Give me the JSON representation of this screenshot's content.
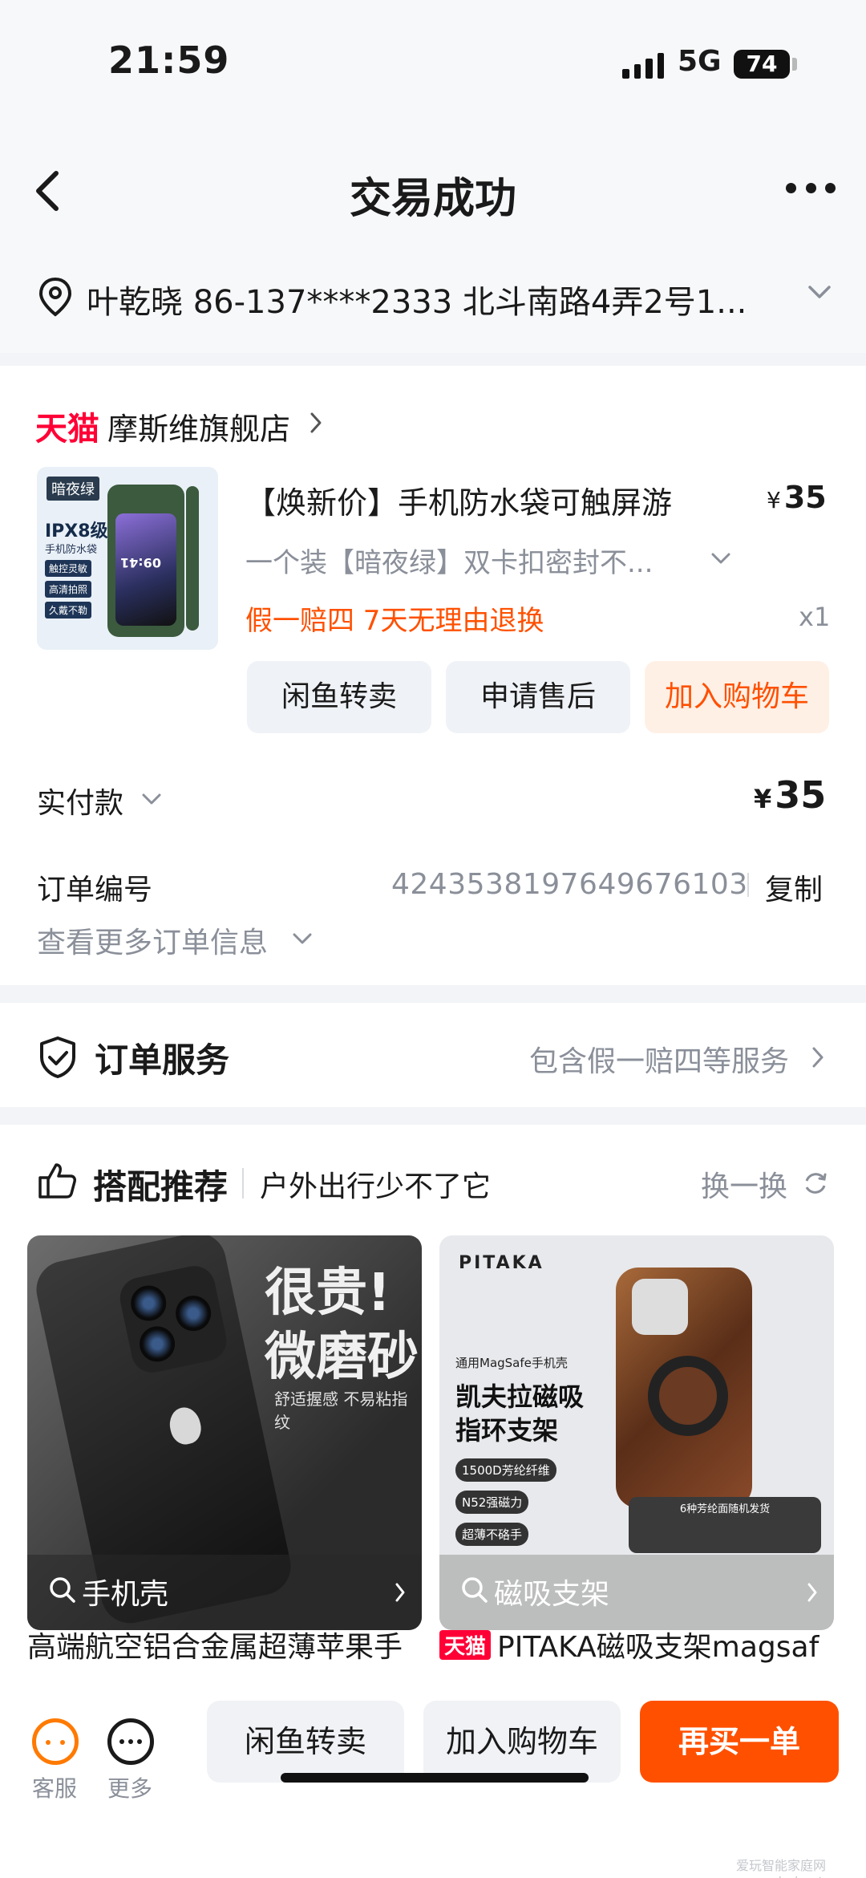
{
  "status_bar": {
    "time": "21:59",
    "network": "5G",
    "battery": "74"
  },
  "header": {
    "title": "交易成功"
  },
  "address": {
    "text": "叶乾晓  86-137****2333  北斗南路4弄2号1..."
  },
  "order": {
    "store": {
      "logo": "天猫",
      "name": "摩斯维旗舰店"
    },
    "product": {
      "image_tags": {
        "night": "暗夜绿",
        "ipx": "IPX8级",
        "ipx_sub": "手机防水袋",
        "t1": "触控灵敏",
        "t2": "高清拍照",
        "t3": "久戴不勒",
        "screen_time": "09:41"
      },
      "title": "【焕新价】手机防水袋可触屏游",
      "price_symbol": "¥",
      "price": "35",
      "spec": "一个装【暗夜绿】双卡扣密封不...",
      "promo": "假一赔四  7天无理由退换",
      "qty": "x1"
    },
    "buttons": {
      "resell": "闲鱼转卖",
      "after_sale": "申请售后",
      "add_cart": "加入购物车"
    },
    "payment": {
      "label": "实付款",
      "symbol": "¥",
      "value": "35"
    },
    "order_no": {
      "label": "订单编号",
      "value": "4243538197649676103",
      "copy": "复制"
    },
    "more_info": "查看更多订单信息"
  },
  "service": {
    "title": "订单服务",
    "link": "包含假一赔四等服务"
  },
  "recommend": {
    "title": "搭配推荐",
    "subtitle": "户外出行少不了它",
    "swap": "换一换",
    "items": [
      {
        "bar_label": "手机壳",
        "caption": "高端航空铝合金属超薄苹果手",
        "img_big1": "很贵!",
        "img_big2": "微磨砂",
        "img_small": "舒适握感 不易粘指纹"
      },
      {
        "bar_label": "磁吸支架",
        "caption_logo": "天猫",
        "caption": "PITAKA磁吸支架magsaf",
        "brand": "PITAKA",
        "img_t1": "通用MagSafe手机壳",
        "img_t2": "凯夫拉磁吸",
        "img_t3": "指环支架",
        "img_f1": "1500D芳纶纤维",
        "img_f2": "N52强磁力",
        "img_f3": "超薄不硌手",
        "img_f4": "6种芳纶面随机发货"
      }
    ]
  },
  "bottom_bar": {
    "service": "客服",
    "more": "更多",
    "resell": "闲鱼转卖",
    "add_cart": "加入购物车",
    "buy_again": "再买一单"
  },
  "watermark": "爱玩智能家庭网 www.ahgj.net",
  "colors": {
    "accent": "#ff5000",
    "tmall_red": "#ff0036",
    "muted": "#8a8f99"
  }
}
